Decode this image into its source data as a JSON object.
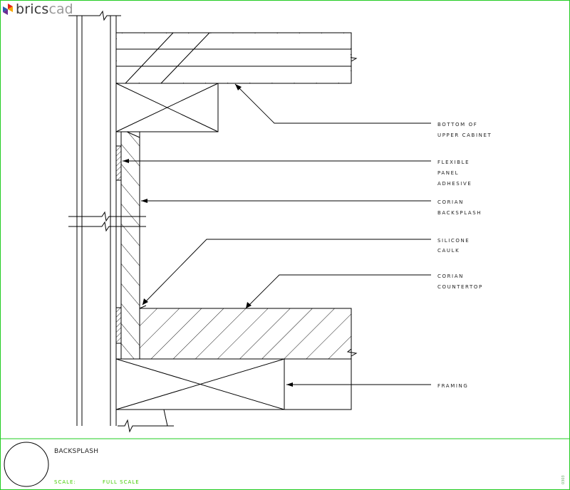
{
  "brand": {
    "name_part1": "brics",
    "name_part2": "cad"
  },
  "callouts": {
    "bottom_upper_cabinet": [
      "BOTTOM OF",
      "UPPER CABINET"
    ],
    "flexible_panel_adhesive": [
      "FLEXIBLE",
      "PANEL",
      "ADHESIVE"
    ],
    "corian_backsplash": [
      "CORIAN",
      "BACKSPLASH"
    ],
    "silicone_caulk": [
      "SILICONE",
      "CAULK"
    ],
    "corian_countertop": [
      "CORIAN",
      "COUNTERTOP"
    ],
    "framing": [
      "FRAMING"
    ]
  },
  "title_block": {
    "title": "BACKSPLASH",
    "scale_label": "SCALE:",
    "scale_value": "FULL SCALE",
    "side_note": "0303"
  },
  "colors": {
    "border": "#22cc22",
    "line": "#000000",
    "label": "#222222",
    "scale_text": "#44cc00"
  }
}
